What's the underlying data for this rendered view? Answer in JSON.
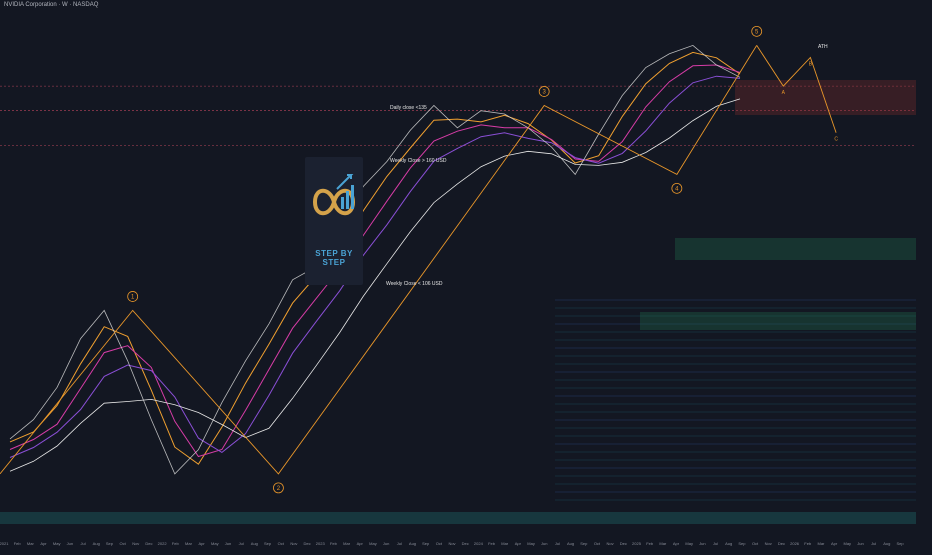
{
  "header": {
    "title": "NVIDIA Corporation · W · NASDAQ"
  },
  "annotations": {
    "daily_close": "Daily close <135",
    "weekly_160": "Weekly Close > 160 USD",
    "weekly_106": "Weekly Close < 106 USD",
    "ath": "ATH"
  },
  "logo": {
    "part1": "STEP BY",
    "part2": "STEP"
  },
  "colors": {
    "background": "#131722",
    "price": "#d7d7d7",
    "ema_orange": "#f0a030",
    "ema_pink": "#d63ca6",
    "ema_purple": "#8a4fd6",
    "sma_white": "#e8e8e8",
    "wave": "#e8962a"
  },
  "chart_data": {
    "type": "line",
    "title": "",
    "xlabel": "",
    "ylabel": "",
    "x_ticks": [
      "2021",
      "Feb",
      "Mar",
      "Apr",
      "May",
      "Jun",
      "Jul",
      "Aug",
      "Sep",
      "Oct",
      "Nov",
      "Dec",
      "2022",
      "Feb",
      "Mar",
      "Apr",
      "May",
      "Jun",
      "Jul",
      "Aug",
      "Sep",
      "Oct",
      "Nov",
      "Dec",
      "2023",
      "Feb",
      "Mar",
      "Apr",
      "May",
      "Jun",
      "Jul",
      "Aug",
      "Sep",
      "Oct",
      "Nov",
      "Dec",
      "2024",
      "Feb",
      "Mar",
      "Apr",
      "May",
      "Jun",
      "Jul",
      "Aug",
      "Sep",
      "Oct",
      "Nov",
      "Dec",
      "2025",
      "Feb",
      "Mar",
      "Apr",
      "May",
      "Jun",
      "Jul",
      "Aug",
      "Sep",
      "Oct",
      "Nov",
      "Dec",
      "2026",
      "Feb",
      "Mar",
      "Apr",
      "May",
      "Jun",
      "Jul",
      "Aug",
      "Sep"
    ],
    "elliott_wave": [
      {
        "label": "1",
        "x": "2021-11",
        "y": 34
      },
      {
        "label": "2",
        "x": "2022-10",
        "y": 11
      },
      {
        "label": "3",
        "x": "2024-06",
        "y": 140
      },
      {
        "label": "4",
        "x": "2025-04",
        "y": 87
      },
      {
        "label": "5",
        "x": "2025-10",
        "y": 212
      }
    ],
    "projection": [
      {
        "label": "A",
        "x": "2025-12",
        "y": 160
      },
      {
        "label": "B",
        "x": "2026-02",
        "y": 195
      },
      {
        "label": "C",
        "x": "2026-04",
        "y": 116
      }
    ],
    "levels": [
      {
        "label": "Daily close <135",
        "y": 135
      },
      {
        "label": "Weekly Close > 160 USD",
        "y": 160
      },
      {
        "label": "Weekly Close < 106 USD",
        "y": 106
      }
    ],
    "series": [
      {
        "values": [
          14,
          16,
          20,
          28,
          34,
          24,
          16,
          11,
          13,
          18,
          24,
          31,
          42,
          46,
          58,
          80,
          95,
          118,
          140,
          120,
          135,
          132,
          120,
          105,
          87,
          115,
          150,
          182,
          200,
          212,
          185,
          170
        ]
      }
    ]
  }
}
